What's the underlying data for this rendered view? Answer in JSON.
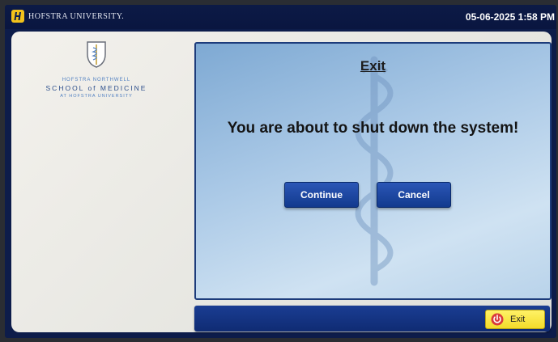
{
  "header": {
    "brand": "HOFSTRA UNIVERSITY.",
    "datetime": "05-06-2025 1:58 PM"
  },
  "sidebar": {
    "school_line1": "HOFSTRA NORTHWELL",
    "school_line2": "SCHOOL of MEDICINE",
    "school_line3": "AT HOFSTRA UNIVERSITY"
  },
  "dialog": {
    "title": "Exit",
    "message": "You are about to shut down the system!",
    "continue_label": "Continue",
    "cancel_label": "Cancel"
  },
  "footer": {
    "exit_label": "Exit"
  },
  "colors": {
    "navy": "#0d1c4a",
    "button_blue": "#1f4aa6",
    "exit_yellow": "#f7e634",
    "exit_icon_red": "#d93a3a"
  }
}
